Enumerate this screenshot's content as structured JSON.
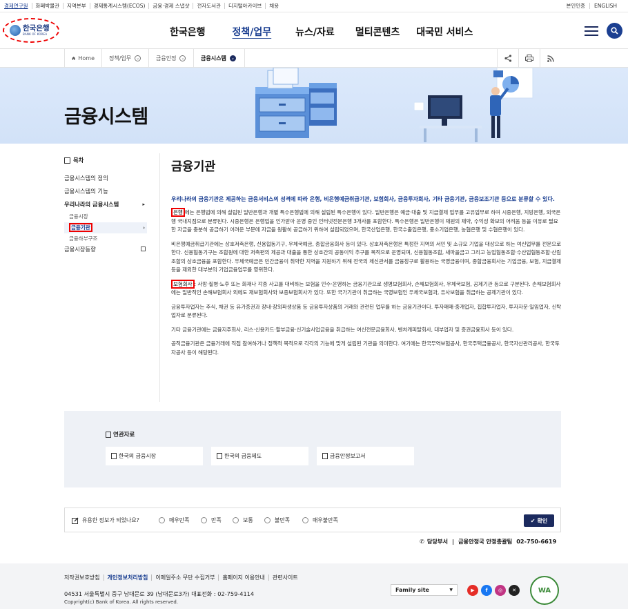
{
  "util": {
    "left_links": [
      "경제연구원",
      "화폐박물관",
      "지역본부",
      "경제통계시스템(ECOS)",
      "금융·경제 스냅샷",
      "전자도서관",
      "디지털아카이브",
      "채용"
    ],
    "right_links": [
      "본인인증",
      "ENGLISH"
    ]
  },
  "header": {
    "logo_ko": "한국은행",
    "logo_en": "BANK OF KOREA",
    "nav": [
      "한국은행",
      "정책/업무",
      "뉴스/자료",
      "멀티콘텐츠",
      "대국민 서비스"
    ],
    "nav_active_index": 1
  },
  "breadcrumb": {
    "home": "Home",
    "items": [
      "정책/업무",
      "금융안정",
      "금융시스템"
    ]
  },
  "banner": {
    "title": "금융시스템"
  },
  "sidebar": {
    "toc_label": "목차",
    "items": [
      {
        "label": "금융시스템의 정의"
      },
      {
        "label": "금융시스템의 기능"
      },
      {
        "label": "우리나라의 금융시스템"
      },
      {
        "label": "금융시장"
      },
      {
        "label": "금융기관"
      },
      {
        "label": "금융하부구조"
      },
      {
        "label": "금융시장동향"
      }
    ]
  },
  "content": {
    "title": "금융기관",
    "lead": "우리나라의 금융기관은 제공하는 금융서비스의 성격에 따라 은행, 비은행예금취급기관, 보험회사, 금융투자회사, 기타 금융기관, 금융보조기관 등으로 분류할 수 있다.",
    "p1_tag": "은행",
    "p1": "에는 은행법에 의해 설립된 일반은행과 개별 특수은행법에 의해 설립된 특수은행이 있다. 일반은행은 예금·대출 및 지급결제 업무를 고유업무로 하여 시중은행, 지방은행, 외국은행 국내지점으로 분류된다. 시중은행은 은행업을 인가받아 운영 중인 인터넷전문은행 3개사를 포함한다. 특수은행은 일반은행이 재원의 제약, 수익성 확보의 어려움 등을 이유로 필요한 자금을 충분히 공급하기 어려운 부문에 자금을 원활히 공급하기 위하여 설립되었으며, 한국산업은행, 한국수출입은행, 중소기업은행, 농협은행 및 수협은행이 있다.",
    "p2": "비은행예금취급기관에는 상호저축은행, 신용협동기구, 우체국예금, 종합금융회사 등이 있다. 상호저축은행은 특정한 지역의 서민 및 소규모 기업을 대상으로 하는 여신업무를 전문으로 한다. 신용협동기구는 조합원에 대한 저축편의 제공과 대출을 통한 상호간의 공동이익 추구를 목적으로 운영되며, 신용협동조합, 새마을금고 그리고 농업협동조합·수산업협동조합·산림조합의 상호금융을 포함한다. 우체국예금은 민간금융이 취약한 지역을 지원하기 위해 전국의 체신관서를 금융창구로 활용하는 국영금융이며, 종합금융회사는 기업금융, 보험, 지급결제 등을 제외한 대부분의 기업금융업무를 영위한다.",
    "p3_tag": "보험회사",
    "p3": ": 사망·질병·노후 또는 화재나 각종 사고를 대비하는 보험을 인수·운영하는 금융기관으로 생명보험회사, 손해보험회사, 우체국보험, 공제기관 등으로 구분된다. 손해보험회사에는 일반적인 손해보험회사 외에도 재보험회사와 보증보험회사가 있다. 또한 국가기관이 취급하는 국영보험인 우체국보험과, 유사보험을 취급하는 공제기관이 있다.",
    "p4": "금융투자업자는 주식, 채권 등 유가증권과 장내·장외파생상품 등 금융투자상품의 거래와 관련된 업무를 하는 금융기관이다. 투자매매·중개업자, 집합투자업자, 투자자문·일임업자, 신탁업자로 분류된다.",
    "p5": "기타 금융기관에는 금융지주회사, 리스·신용카드·할부금융·신기술사업금융을 취급하는 여신전문금융회사, 벤처캐피탈회사, 대부업자 및 증권금융회사 등이 있다.",
    "p6": "공적금융기관은 금융거래에 직접 참여하거나 정책적 목적으로 각각의 기능에 맞게 설립된 기관을 의미한다. 여기에는 한국무역보험공사, 한국주택금융공사, 한국자산관리공사, 한국투자공사 등이 해당된다."
  },
  "related": {
    "title": "연관자료",
    "cards": [
      "한국의 금융시장",
      "한국의 금융제도",
      "금융안정보고서"
    ]
  },
  "survey": {
    "question": "유용한 정보가 되었나요?",
    "options": [
      "매우만족",
      "만족",
      "보통",
      "불만족",
      "매우불만족"
    ],
    "submit": "확인"
  },
  "dept": {
    "label": "담당부서",
    "name": "금융안정국 안정총괄팀",
    "phone": "02-750-6619"
  },
  "footer": {
    "links": [
      "저작권보호방침",
      "개인정보처리방침",
      "이메일주소 무단 수집거부",
      "홈페이지 이용안내",
      "관련사이트"
    ],
    "address": "04531 서울특별시 중구 남대문로 39 (남대문로3가) 대표전화 : 02-759-4114",
    "copyright": "Copyright(c) Bank of Korea. All rights reserved.",
    "family_site": "Family site",
    "sns": [
      "youtube-icon",
      "facebook-icon",
      "instagram-icon",
      "x-icon"
    ],
    "badge": "WA"
  }
}
